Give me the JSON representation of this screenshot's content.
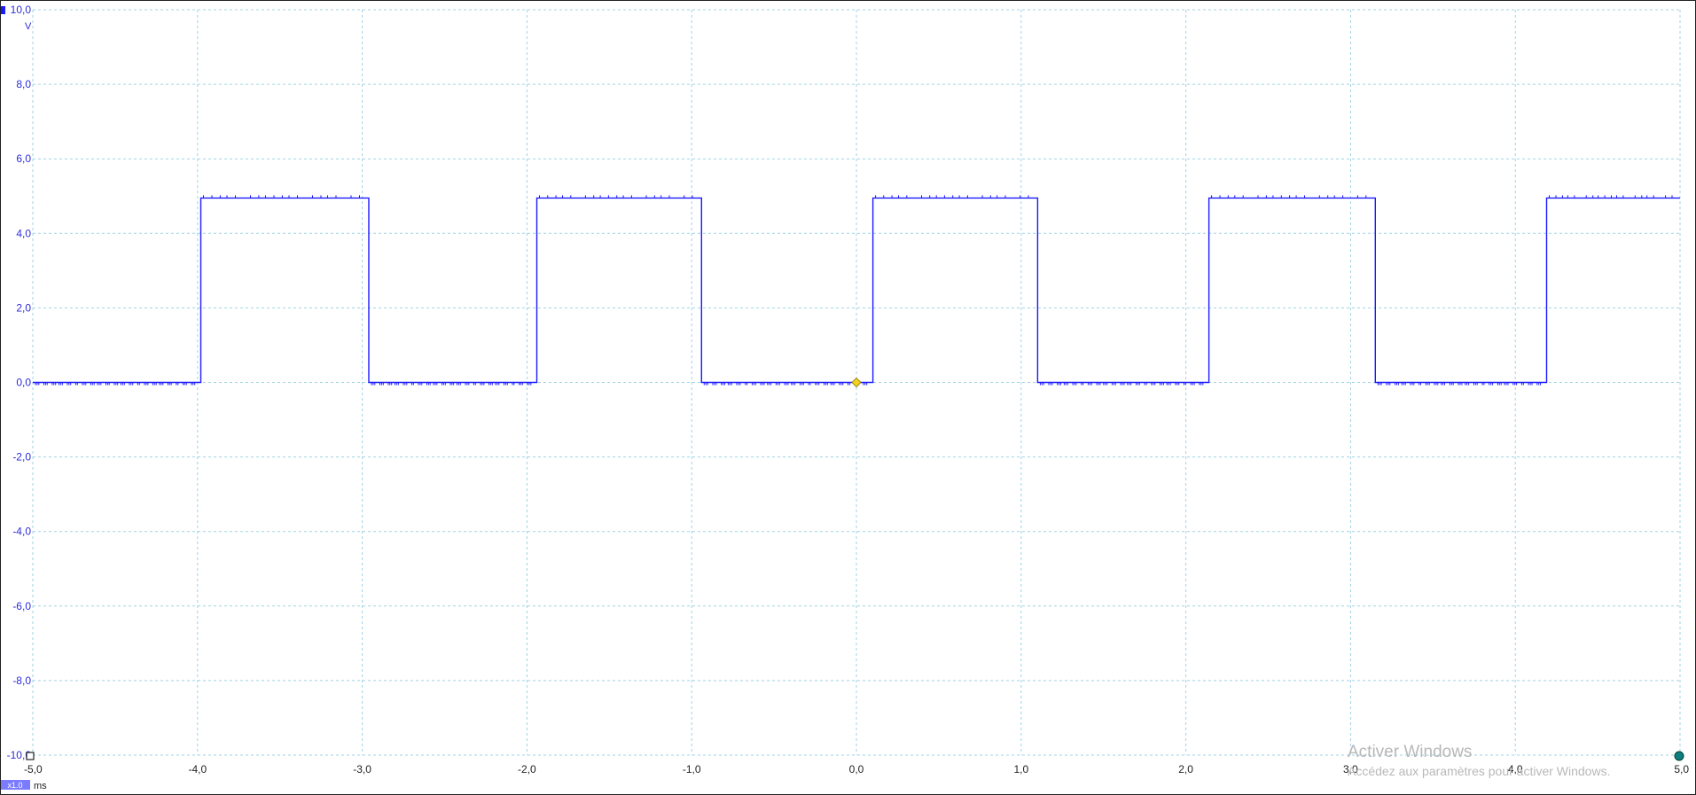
{
  "chart_data": {
    "type": "line",
    "y_axis": {
      "unit": "V",
      "ylim": [
        -10,
        10
      ],
      "ticks": [
        "10,0",
        "8,0",
        "6,0",
        "4,0",
        "2,0",
        "0,0",
        "-2,0",
        "-4,0",
        "-6,0",
        "-8,0",
        "-10,0"
      ],
      "tick_values": [
        10,
        8,
        6,
        4,
        2,
        0,
        -2,
        -4,
        -6,
        -8,
        -10
      ]
    },
    "x_axis": {
      "unit": "ms",
      "xlim": [
        -5,
        5
      ],
      "ticks": [
        "-5,0",
        "-4,0",
        "-3,0",
        "-2,0",
        "-1,0",
        "0,0",
        "1,0",
        "2,0",
        "3,0",
        "4,0",
        "5,0"
      ],
      "tick_values": [
        -5,
        -4,
        -3,
        -2,
        -1,
        0,
        1,
        2,
        3,
        4,
        5
      ],
      "zoom": "x1.0"
    },
    "grid": true,
    "series": [
      {
        "color": "#1a1aff",
        "low": 0,
        "high": 4.95,
        "x": [
          -5.0,
          -3.98,
          -3.98,
          -2.96,
          -2.96,
          -1.94,
          -1.94,
          -0.94,
          -0.94,
          0.1,
          0.1,
          1.1,
          1.1,
          2.14,
          2.14,
          3.15,
          3.15,
          4.19,
          4.19,
          5.0
        ],
        "y": [
          0,
          0,
          4.95,
          4.95,
          0,
          0,
          4.95,
          4.95,
          0,
          0,
          4.95,
          4.95,
          0,
          0,
          4.95,
          4.95,
          0,
          0,
          4.95,
          4.95
        ]
      }
    ],
    "trigger_marker": {
      "x": 0.0,
      "y": 0.0,
      "color": "#f2d21a"
    }
  },
  "colors": {
    "trace": "#1a1aff",
    "grid": "#9fd3e6",
    "y_labels": "#2b2bdc",
    "x_labels": "#222222",
    "trigger": "#f2d21a",
    "end_marker": "#0d7f7f"
  },
  "watermark": {
    "line1": "Activer Windows",
    "line2": "Accédez aux paramètres pour activer Windows."
  }
}
